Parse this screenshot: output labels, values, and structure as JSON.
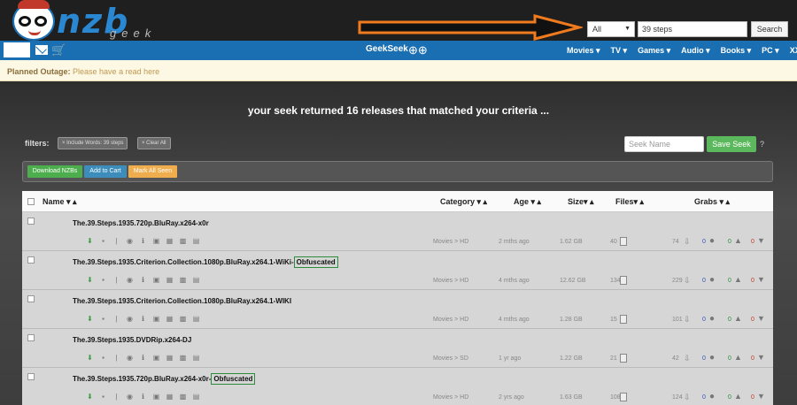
{
  "logo": {
    "brand": "nzb",
    "sub": "geek"
  },
  "search": {
    "scope": "All",
    "query": "39 steps",
    "button": "Search"
  },
  "nav": {
    "brand": "GeekSeek",
    "items": [
      "Movies ▾",
      "TV ▾",
      "Games ▾",
      "Audio ▾",
      "Books ▾",
      "PC ▾",
      "XXX ▾"
    ]
  },
  "alert": {
    "title": "Planned Outage:",
    "text": "Please have a read here"
  },
  "results": {
    "headline": "your seek returned 16 releases that matched your criteria ..."
  },
  "filters": {
    "label": "filters:",
    "tags": [
      "× Include Words: 39 steps",
      "× Clear All"
    ]
  },
  "seek": {
    "placeholder": "Seek Name",
    "save": "Save Seek",
    "help": "?"
  },
  "actions": {
    "download": "Download NZBs",
    "cart": "Add to Cart",
    "seen": "Mark All Seen"
  },
  "colors": {
    "download": "#4cae4c",
    "cart": "#3c8dbc",
    "seen": "#f0ad4e"
  },
  "columns": {
    "name": "Name ▾ ▴",
    "category": "Category ▾ ▴",
    "age": "Age ▾ ▴",
    "size": "Size▾ ▴",
    "files": "Files▾ ▴",
    "grabs": "Grabs ▾ ▴"
  },
  "rows": [
    {
      "name": "The.39.Steps.1935.720p.BluRay.x264-x0r",
      "tag": "",
      "category": "Movies > HD",
      "age": "2 mths ago",
      "size": "1.62 GB",
      "files": "40",
      "grabs": "74",
      "comments": "0",
      "up": "0",
      "down": "0"
    },
    {
      "name": "The.39.Steps.1935.Criterion.Collection.1080p.BluRay.x264.1-WiKi-",
      "tag": "Obfuscated",
      "category": "Movies > HD",
      "age": "4 mths ago",
      "size": "12.62 GB",
      "files": "134",
      "grabs": "229",
      "comments": "0",
      "up": "0",
      "down": "0"
    },
    {
      "name": "The.39.Steps.1935.Criterion.Collection.1080p.BluRay.x264.1-WIKI",
      "tag": "",
      "category": "Movies > HD",
      "age": "4 mths ago",
      "size": "1.28 GB",
      "files": "15",
      "grabs": "101",
      "comments": "0",
      "up": "0",
      "down": "0"
    },
    {
      "name": "The.39.Steps.1935.DVDRip.x264-DJ",
      "tag": "",
      "category": "Movies > SD",
      "age": "1 yr ago",
      "size": "1.22 GB",
      "files": "21",
      "grabs": "42",
      "comments": "0",
      "up": "0",
      "down": "0"
    },
    {
      "name": "The.39.Steps.1935.720p.BluRay.x264-x0r-",
      "tag": "Obfuscated",
      "category": "Movies > HD",
      "age": "2 yrs ago",
      "size": "1.63 GB",
      "files": "108",
      "grabs": "124",
      "comments": "0",
      "up": "0",
      "down": "0"
    }
  ]
}
